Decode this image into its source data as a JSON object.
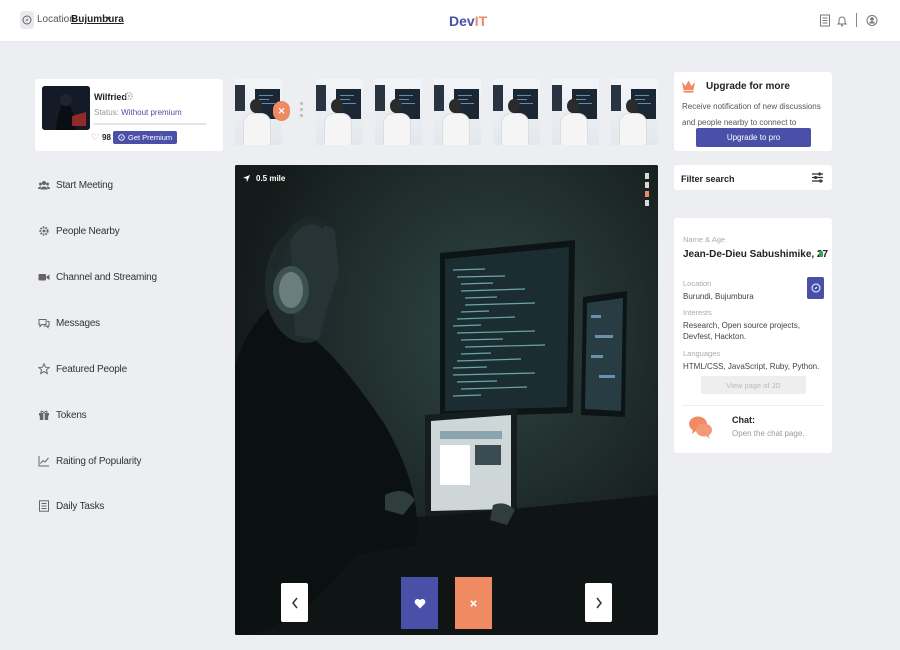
{
  "header": {
    "location_label": "Location:",
    "location_value": "Bujumbura",
    "brand_main": "Dev",
    "brand_accent": "IT"
  },
  "profile": {
    "name": "Wilfried",
    "status_label": "Status:",
    "status_value": "Without premium",
    "likes": "98",
    "premium_button": "Get Premium"
  },
  "sidebar": {
    "items": [
      {
        "label": "Start Meeting",
        "icon": "people-icon"
      },
      {
        "label": "People Nearby",
        "icon": "gear-icon"
      },
      {
        "label": "Channel and Streaming",
        "icon": "video-icon"
      },
      {
        "label": "Messages",
        "icon": "chat-icon"
      },
      {
        "label": "Featured People",
        "icon": "star-icon"
      },
      {
        "label": "Tokens",
        "icon": "gift-icon"
      },
      {
        "label": "Raiting of Popularity",
        "icon": "chart-icon"
      },
      {
        "label": "Daily Tasks",
        "icon": "list-icon"
      }
    ]
  },
  "main": {
    "distance": "0.5 mile",
    "like_icon": "heart-icon",
    "dislike_icon": "close-icon"
  },
  "upgrade": {
    "title": "Upgrade for more",
    "text": "Receive notification of new discussions and people nearby to connect to",
    "button": "Upgrade to pro"
  },
  "filter": {
    "label": "Filter search"
  },
  "details": {
    "name_label": "Name & Age",
    "name_value": "Jean-De-Dieu Sabushimike, 27",
    "location_label": "Location",
    "location_value": "Burundi, Bujumbura",
    "interests_label": "Interests",
    "interests_value": "Research, Open source projects, Devfest, Hackton.",
    "languages_label": "Languages",
    "languages_value": "HTML/CSS, JavaScript, Ruby, Python.",
    "view_button": "View page of JD",
    "chat_title": "Chat:",
    "chat_sub": "Open the chat page."
  },
  "colors": {
    "accent": "#4a4fa8",
    "orange": "#ef8a62",
    "online": "#3aa648"
  }
}
